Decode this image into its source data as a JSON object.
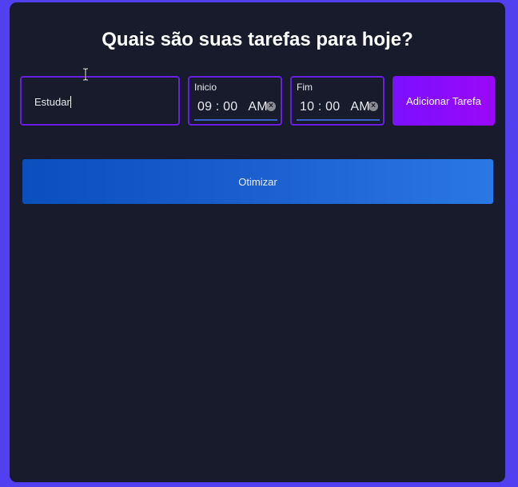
{
  "header": {
    "title": "Quais são suas tarefas para hoje?"
  },
  "task_form": {
    "task_input": {
      "value": "Estudar"
    },
    "start_time": {
      "label": "Inicio",
      "value": "09 : 00   AM"
    },
    "end_time": {
      "label": "Fim",
      "value": "10 : 00   AM"
    },
    "add_button_label": "Adicionar Tarefa"
  },
  "optimize_button_label": "Otimizar",
  "colors": {
    "page_background": "#5040f0",
    "panel_background": "#171b2b",
    "input_border": "#6a1fe0",
    "add_button": "#8a0cfc",
    "optimize_button": "#1c5fcf",
    "time_underline": "#3a63c8"
  },
  "icons": {
    "clear": "clear-circle-icon",
    "cursor": "text-cursor-icon"
  }
}
